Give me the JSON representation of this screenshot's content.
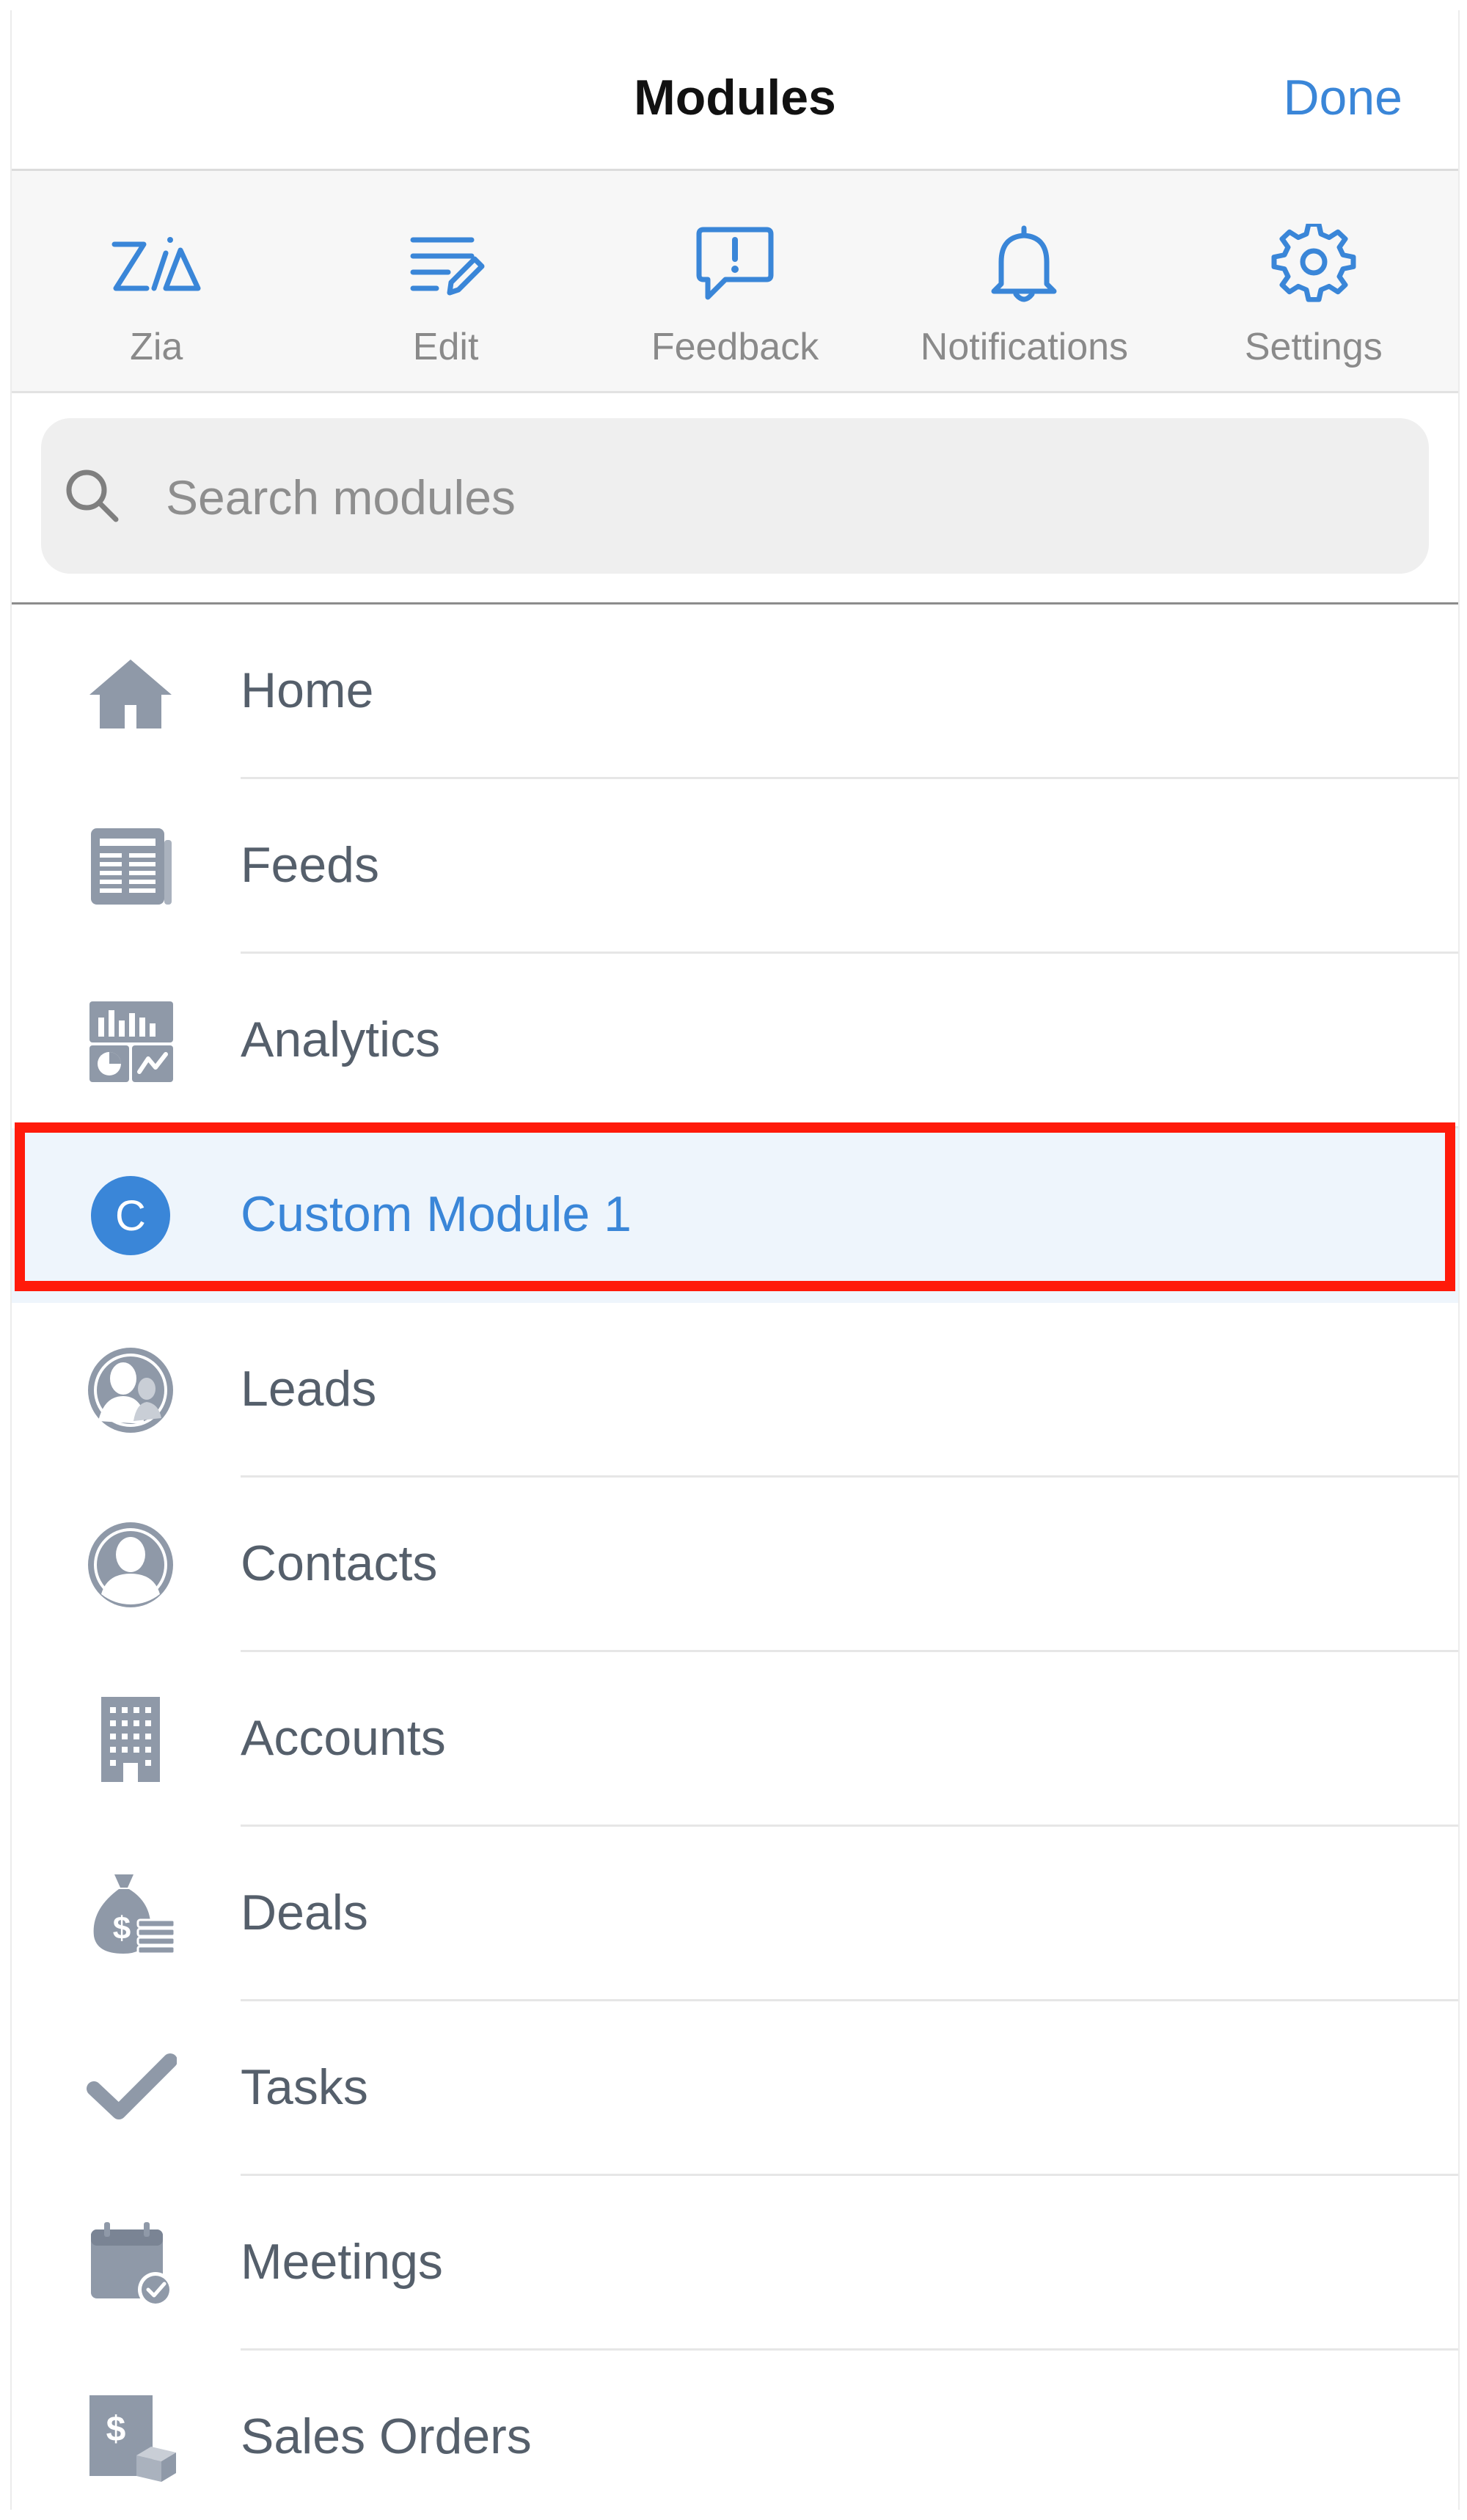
{
  "navbar": {
    "title": "Modules",
    "done_label": "Done"
  },
  "toolbar": {
    "items": [
      {
        "label": "Zia",
        "icon": "zia-icon"
      },
      {
        "label": "Edit",
        "icon": "edit-icon"
      },
      {
        "label": "Feedback",
        "icon": "feedback-icon"
      },
      {
        "label": "Notifications",
        "icon": "bell-icon"
      },
      {
        "label": "Settings",
        "icon": "gear-icon"
      }
    ]
  },
  "search": {
    "placeholder": "Search modules"
  },
  "modules": {
    "items": [
      {
        "label": "Home",
        "icon": "home-icon"
      },
      {
        "label": "Feeds",
        "icon": "feeds-icon"
      },
      {
        "label": "Analytics",
        "icon": "analytics-icon"
      },
      {
        "label": "Custom Module 1",
        "icon": "custom-module-icon",
        "icon_letter": "C",
        "selected": true
      },
      {
        "label": "Leads",
        "icon": "leads-icon"
      },
      {
        "label": "Contacts",
        "icon": "contacts-icon"
      },
      {
        "label": "Accounts",
        "icon": "accounts-icon"
      },
      {
        "label": "Deals",
        "icon": "deals-icon"
      },
      {
        "label": "Tasks",
        "icon": "tasks-icon"
      },
      {
        "label": "Meetings",
        "icon": "meetings-icon"
      },
      {
        "label": "Sales Orders",
        "icon": "sales-orders-icon"
      }
    ]
  },
  "colors": {
    "accent": "#3a86d8",
    "highlight": "#ff1a0a",
    "icon_gray": "#8f99a8",
    "label_gray": "#555f6b"
  }
}
